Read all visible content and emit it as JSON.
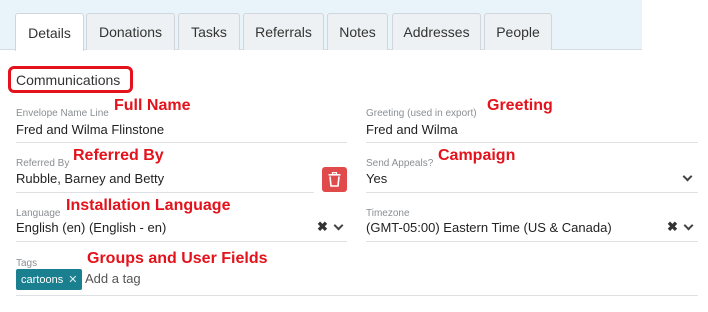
{
  "tabs": [
    "Details",
    "Donations",
    "Tasks",
    "Referrals",
    "Notes",
    "Addresses",
    "People"
  ],
  "section_title": "Communications",
  "fields": {
    "envelope": {
      "label": "Envelope Name Line",
      "value": "Fred and Wilma Flinstone",
      "annotation": "Full Name"
    },
    "greeting": {
      "label": "Greeting (used in export)",
      "value": "Fred and Wilma",
      "annotation": "Greeting"
    },
    "referred_by": {
      "label": "Referred By",
      "value": "Rubble, Barney and Betty",
      "annotation": "Referred By"
    },
    "send_appeals": {
      "label": "Send Appeals?",
      "value": "Yes",
      "annotation": "Campaign"
    },
    "language": {
      "label": "Language",
      "value": "English (en) (English - en)",
      "annotation": "Installation Language"
    },
    "timezone": {
      "label": "Timezone",
      "value": "(GMT-05:00) Eastern Time (US & Canada)"
    },
    "tags": {
      "label": "Tags",
      "annotation": "Groups and User Fields",
      "chip": "cartoons",
      "placeholder": "Add a tag"
    }
  },
  "colors": {
    "annotation": "#e3121b",
    "tag_chip": "#1a7f8e",
    "delete_button": "#e04a4a",
    "tabbar": "#e9f3fa"
  },
  "icons": [
    "trash-icon",
    "clear-x-icon",
    "chevron-down-icon",
    "tag-remove-icon"
  ]
}
